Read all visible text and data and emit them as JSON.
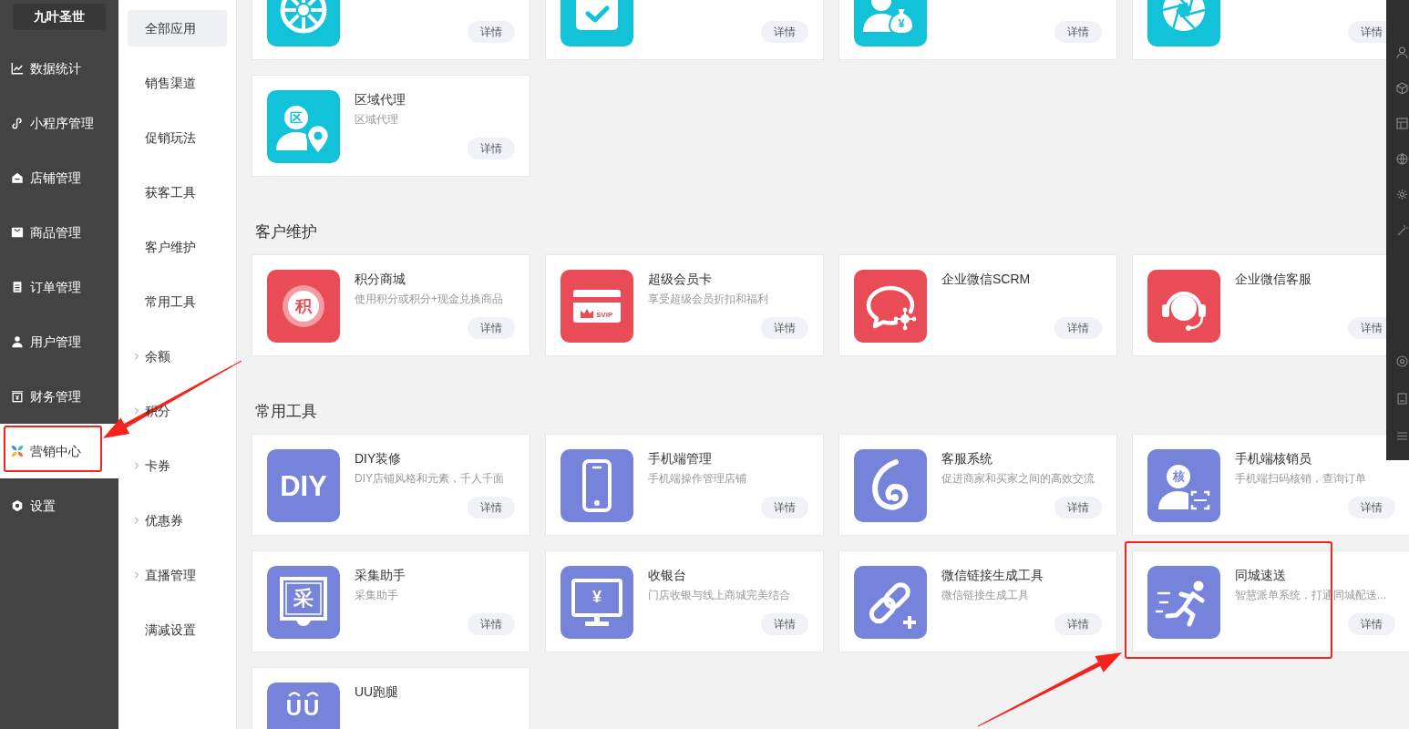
{
  "logo": {
    "text": "九叶圣世"
  },
  "main_nav": [
    {
      "label": "数据统计",
      "selected": false
    },
    {
      "label": "小程序管理",
      "selected": false
    },
    {
      "label": "店铺管理",
      "selected": false
    },
    {
      "label": "商品管理",
      "selected": false
    },
    {
      "label": "订单管理",
      "selected": false
    },
    {
      "label": "用户管理",
      "selected": false
    },
    {
      "label": "财务管理",
      "selected": false
    },
    {
      "label": "营销中心",
      "selected": true
    },
    {
      "label": "设置",
      "selected": false
    }
  ],
  "sub_nav": [
    {
      "label": "全部应用",
      "kind": "link",
      "selected": true
    },
    {
      "label": "销售渠道",
      "kind": "link",
      "selected": false
    },
    {
      "label": "促销玩法",
      "kind": "link",
      "selected": false
    },
    {
      "label": "获客工具",
      "kind": "link",
      "selected": false
    },
    {
      "label": "客户维护",
      "kind": "link",
      "selected": false
    },
    {
      "label": "常用工具",
      "kind": "link",
      "selected": false
    },
    {
      "label": "余额",
      "kind": "group",
      "selected": false
    },
    {
      "label": "积分",
      "kind": "group",
      "selected": false
    },
    {
      "label": "卡券",
      "kind": "group",
      "selected": false
    },
    {
      "label": "优惠券",
      "kind": "group",
      "selected": false
    },
    {
      "label": "直播管理",
      "kind": "group",
      "selected": false
    },
    {
      "label": "满减设置",
      "kind": "link",
      "selected": false
    }
  ],
  "sections": [
    {
      "color": "#12c2d9",
      "cards": [
        {
          "button": "详情"
        },
        {
          "button": "详情"
        },
        {
          "icon_text": "¥",
          "button": "详情"
        },
        {
          "button": "详情"
        },
        {
          "title": "区域代理",
          "description": "区域代理",
          "icon_text": "区",
          "button": "详情"
        }
      ]
    },
    {
      "title": "客户维护",
      "color": "#ea4c57",
      "cards": [
        {
          "title": "积分商城",
          "description": "使用积分或积分+现金兑换商品",
          "icon_text": "积",
          "button": "详情"
        },
        {
          "title": "超级会员卡",
          "description": "享受超级会员折扣和福利",
          "icon_text": "SVIP",
          "button": "详情"
        },
        {
          "title": "企业微信SCRM",
          "button": "详情"
        },
        {
          "title": "企业微信客服",
          "button": "详情"
        }
      ]
    },
    {
      "title": "常用工具",
      "color": "#7584da",
      "cards": [
        {
          "title": "DIY装修",
          "description": "DIY店铺风格和元素，千人千面",
          "icon_text": "DIY",
          "button": "详情"
        },
        {
          "title": "手机端管理",
          "description": "手机端操作管理店铺",
          "button": "详情"
        },
        {
          "title": "客服系统",
          "description": "促进商家和买家之间的高效交流",
          "button": "详情"
        },
        {
          "title": "手机端核销员",
          "description": "手机端扫码核销，查询订单",
          "icon_text": "核",
          "button": "详情"
        },
        {
          "title": "采集助手",
          "description": "采集助手",
          "icon_text": "采",
          "button": "详情"
        },
        {
          "title": "收银台",
          "description": "门店收银与线上商城完美结合",
          "icon_text": "¥",
          "button": "详情"
        },
        {
          "title": "微信链接生成工具",
          "description": "微信链接生成工具",
          "button": "详情"
        },
        {
          "title": "同城速送",
          "description": "智慧派单系统，打通同城配送...",
          "button": "详情"
        },
        {
          "title": "UU跑腿",
          "icon_text": "UU"
        }
      ]
    }
  ]
}
